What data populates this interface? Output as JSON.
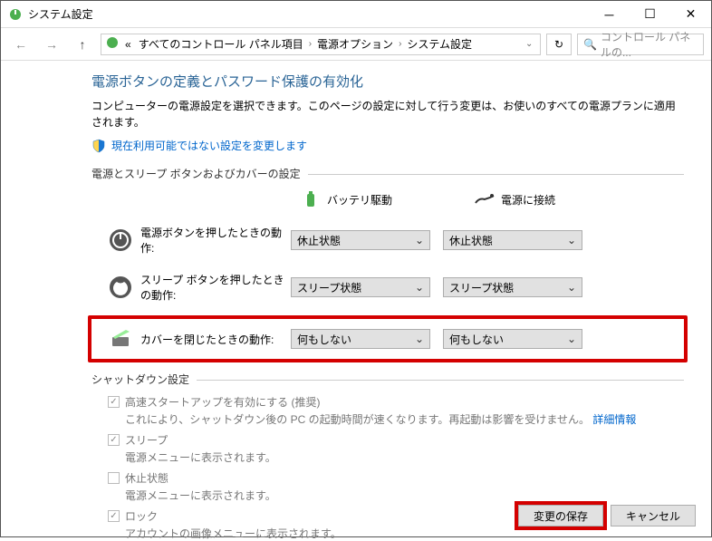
{
  "window": {
    "title": "システム設定"
  },
  "navbar": {
    "breadcrumb": [
      "すべてのコントロール パネル項目",
      "電源オプション",
      "システム設定"
    ],
    "bc_prefix": "«",
    "search_placeholder": "コントロール パネルの..."
  },
  "page": {
    "title": "電源ボタンの定義とパスワード保護の有効化",
    "description": "コンピューターの電源設定を選択できます。このページの設定に対して行う変更は、お使いのすべての電源プランに適用されます。",
    "admin_link": "現在利用可能ではない設定を変更します"
  },
  "sections": {
    "buttons_cover": "電源とスリープ ボタンおよびカバーの設定",
    "shutdown": "シャットダウン設定"
  },
  "columns": {
    "battery": "バッテリ駆動",
    "plugged": "電源に接続"
  },
  "rows": {
    "power_button": {
      "label": "電源ボタンを押したときの動作:",
      "battery": "休止状態",
      "plugged": "休止状態"
    },
    "sleep_button": {
      "label": "スリープ ボタンを押したときの動作:",
      "battery": "スリープ状態",
      "plugged": "スリープ状態"
    },
    "lid_close": {
      "label": "カバーを閉じたときの動作:",
      "battery": "何もしない",
      "plugged": "何もしない"
    }
  },
  "shutdown_opts": {
    "fast_startup": {
      "label": "高速スタートアップを有効にする (推奨)",
      "desc_prefix": "これにより、シャットダウン後の PC の起動時間が速くなります。再起動は影響を受けません。",
      "link": "詳細情報"
    },
    "sleep": {
      "label": "スリープ",
      "desc": "電源メニューに表示されます。"
    },
    "hibernate": {
      "label": "休止状態",
      "desc": "電源メニューに表示されます。"
    },
    "lock": {
      "label": "ロック",
      "desc": "アカウントの画像メニューに表示されます。"
    }
  },
  "buttons": {
    "save": "変更の保存",
    "cancel": "キャンセル"
  }
}
